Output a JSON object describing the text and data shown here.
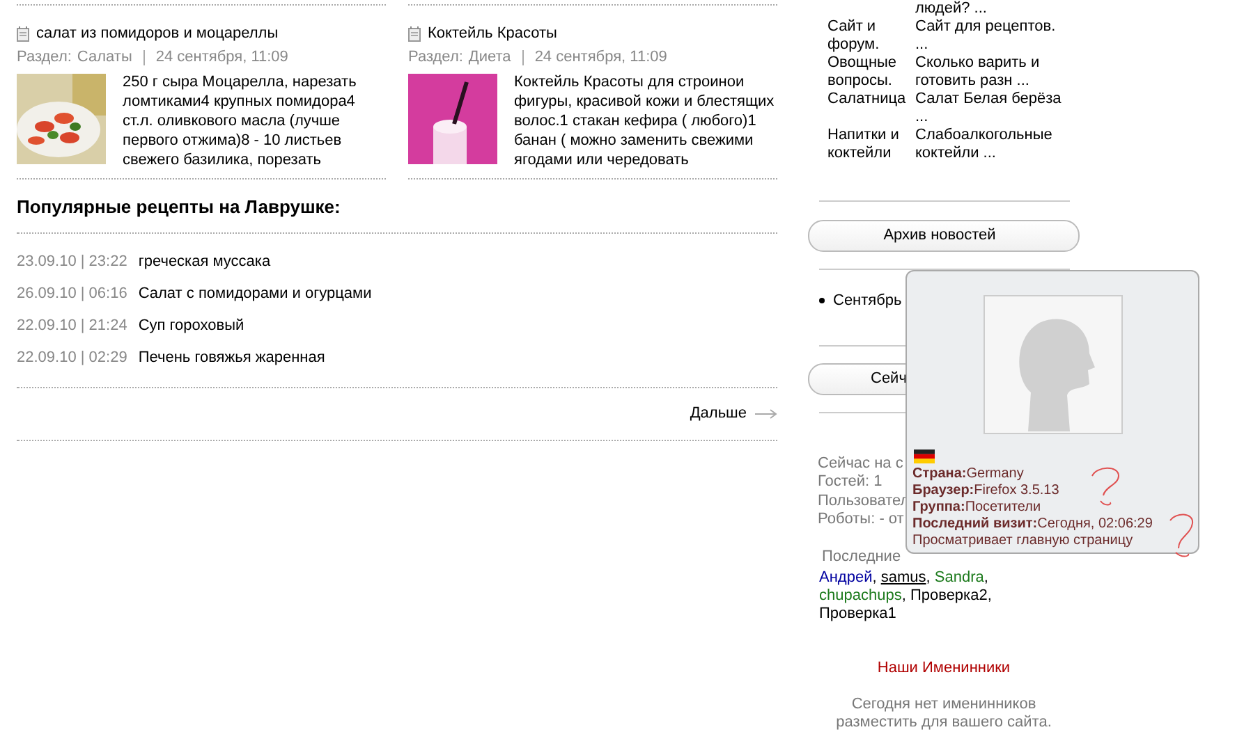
{
  "articles": [
    {
      "title": "салат из помидоров и моцареллы",
      "section_label": "Раздел:",
      "section": "Салаты",
      "date": "24 сентября, 11:09",
      "excerpt": "250 г сыра Моцарелла, нарезать ломтиками4 крупных помидора4 ст.л. оливкового масла (лучше первого отжима)8 - 10 листьев свежего базилика, порезать"
    },
    {
      "title": "Коктейль Красоты",
      "section_label": "Раздел:",
      "section": "Диета",
      "date": "24 сентября, 11:09",
      "excerpt": "Коктейль Красоты для строинои фигуры, красивой кожи и блестящих волос.1 стакан кефира ( любого)1 банан ( можно заменить свежими ягодами или чередовать"
    }
  ],
  "popular": {
    "title": "Популярные рецепты на Лаврушке:",
    "items": [
      {
        "stamp": "23.09.10 | 23:22",
        "title": "греческая муссака"
      },
      {
        "stamp": "26.09.10 | 06:16",
        "title": "Салат с помидорами и огурцами"
      },
      {
        "stamp": "22.09.10 | 21:24",
        "title": "Суп гороховый"
      },
      {
        "stamp": "22.09.10 | 02:29",
        "title": "Печень говяжья жаренная"
      }
    ],
    "more_link": "Дальше"
  },
  "sidebar": {
    "top_cut_link": "людей? ...",
    "link_rows": [
      {
        "category": "Сайт и форум.",
        "topic": "Сайт для рецептов. ..."
      },
      {
        "category": "Овощные вопросы.",
        "topic": "Сколько варить и готовить разн ..."
      },
      {
        "category": "Салатница",
        "topic": "Салат Белая берёза ..."
      },
      {
        "category": "Напитки и коктейли",
        "topic": "Слабоалкогольные коктейли ..."
      }
    ],
    "archive_button": "Архив новостей",
    "archive_items": [
      {
        "month": "Сентябрь"
      }
    ],
    "online_button": "Сейч",
    "stats": [
      "Сейчас на с",
      "Гостей: 1",
      "Пользовател",
      "Роботы: - от"
    ],
    "recent_label": "Последние",
    "recent_users_separator": ",",
    "recent_users": [
      {
        "name": "Андрей",
        "color": "#0000a0",
        "underlined": false
      },
      {
        "name": "samus",
        "color": "#000000",
        "underlined": true
      },
      {
        "name": "Sandra",
        "color": "#1c7a1c",
        "underlined": false
      },
      {
        "name": "chupachups",
        "color": "#1c7a1c",
        "underlined": false
      },
      {
        "name": "Проверка2",
        "color": "#000000",
        "underlined": false
      },
      {
        "name": "Проверка1",
        "color": "#000000",
        "underlined": false
      }
    ],
    "birthdays_title": "Наши Именинники",
    "birthdays_text": "Сегодня нет именинников разместить для вашего сайта."
  },
  "popup": {
    "fields": [
      {
        "label": "Страна:",
        "value": "Germany"
      },
      {
        "label": "Браузер:",
        "value": "Firefox 3.5.13"
      },
      {
        "label": "Группа:",
        "value": "Посетители"
      },
      {
        "label": "Последний визит:",
        "value": "Сегодня, 02:06:29"
      }
    ],
    "note": "Просматривает главную страницу"
  }
}
